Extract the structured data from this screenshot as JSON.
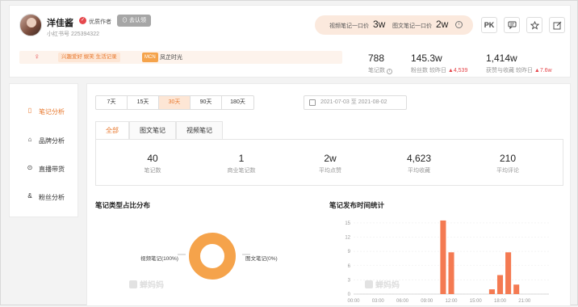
{
  "profile": {
    "name": "洋佳酱",
    "author_tag": "优质作者",
    "bind_button": "去认领",
    "id_label": "小红书号",
    "id_value": "225394322"
  },
  "quotes": {
    "video_label": "视频笔记一口价",
    "video_value": "3w",
    "image_label": "图文笔记一口价",
    "image_value": "2w",
    "info_icon": "i"
  },
  "header_buttons": {
    "pk_label": "PK"
  },
  "tags": {
    "gender_icon": "♀",
    "interest": "兴趣爱好 娱笑 生活记录",
    "mcn_badge": "MCN",
    "mcn_name": "凤芷时光"
  },
  "header_stats": [
    {
      "value": "788",
      "label": "笔记数",
      "delta": ""
    },
    {
      "value": "145.3w",
      "label": "粉丝数  较昨日 ",
      "delta": "▲4,539"
    },
    {
      "value": "1,414w",
      "label": "获赞与收藏  较昨日 ",
      "delta": "▲7.6w"
    }
  ],
  "sidebar": {
    "items": [
      {
        "label": "笔记分析",
        "icon": "note-icon",
        "active": true
      },
      {
        "label": "品牌分析",
        "icon": "bag-icon",
        "active": false
      },
      {
        "label": "直播带货",
        "icon": "live-icon",
        "active": false
      },
      {
        "label": "粉丝分析",
        "icon": "fans-icon",
        "active": false
      }
    ]
  },
  "ranges": [
    "7天",
    "15天",
    "30天",
    "90天",
    "180天"
  ],
  "active_range": "30天",
  "date_range": {
    "start": "2021-07-03",
    "sep": "至",
    "end": "2021-08-02"
  },
  "note_tabs": [
    "全部",
    "图文笔记",
    "视频笔记"
  ],
  "summary": [
    {
      "value": "40",
      "label": "笔记数"
    },
    {
      "value": "1",
      "label": "商业笔记数"
    },
    {
      "value": "2w",
      "label": "平均点赞"
    },
    {
      "value": "4,623",
      "label": "平均收藏"
    },
    {
      "value": "210",
      "label": "平均评论"
    }
  ],
  "sections": {
    "type_dist_title": "笔记类型占比分布",
    "time_dist_title": "笔记发布时间统计",
    "watermark": "蝉妈妈"
  },
  "colors": {
    "accent": "#e8792f",
    "donut": "#f5a34b",
    "bar": "#f47a52"
  },
  "chart_data": [
    {
      "type": "pie",
      "labels": [
        "视频笔记(100%)",
        "图文笔记(0%)"
      ],
      "categories": [
        "视频笔记",
        "图文笔记"
      ],
      "values": [
        100,
        0
      ]
    },
    {
      "type": "bar",
      "x_ticks": [
        "00:00",
        "03:00",
        "06:00",
        "09:00",
        "12:00",
        "15:00",
        "18:00",
        "21:00"
      ],
      "y_ticks": [
        0,
        3,
        6,
        9,
        12,
        15
      ],
      "ylim": [
        0,
        16
      ],
      "x": [
        11,
        12,
        17,
        18,
        19,
        20
      ],
      "values": [
        15.5,
        8.8,
        1,
        4,
        8.8,
        2
      ]
    }
  ]
}
